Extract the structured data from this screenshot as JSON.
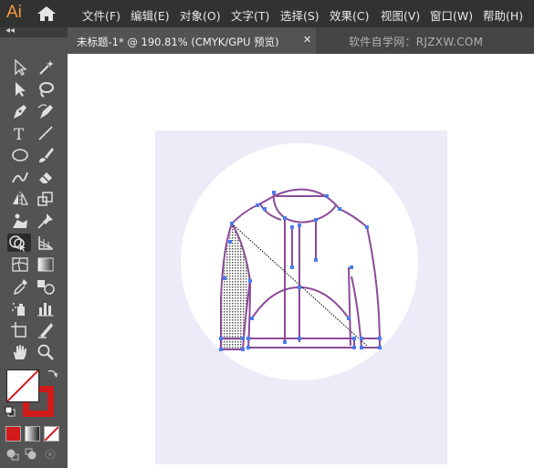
{
  "app": {
    "logo": "Ai"
  },
  "menu": [
    "文件(F)",
    "编辑(E)",
    "对象(O)",
    "文字(T)",
    "选择(S)",
    "效果(C)",
    "视图(V)",
    "窗口(W)",
    "帮助(H)"
  ],
  "document_tab": {
    "title": "未标题-1* @ 190.81% (CMYK/GPU 预览)",
    "close_glyph": "✕"
  },
  "watermark": "软件自学网：RJZXW.COM",
  "toolbar": {
    "collapse_glyph": "◂◂",
    "tools": [
      "selection-tool",
      "direct-selection-tool",
      "pen-tool",
      "curvature-tool",
      "type-tool",
      "line-segment-tool",
      "ellipse-tool",
      "paintbrush-tool",
      "shaper-tool",
      "eraser-tool",
      "reflect-tool",
      "scale-tool",
      "puppet-warp-tool",
      "pin-tool",
      "shape-builder-tool",
      "perspective-grid-tool",
      "mesh-tool",
      "gradient-tool",
      "eyedropper-tool",
      "blend-tool",
      "symbol-sprayer-tool",
      "column-graph-tool",
      "artboard-tool",
      "slice-tool",
      "hand-tool",
      "zoom-tool"
    ]
  },
  "colors": {
    "menubar": "#323232",
    "toolbar": "#535353",
    "accent_logo": "#f39c3b",
    "artboard_bg": "#ecebf7",
    "jacket_stroke": "#8b4a97",
    "anchor": "#4a7cf0",
    "stroke_swatch": "#d11a1a"
  }
}
